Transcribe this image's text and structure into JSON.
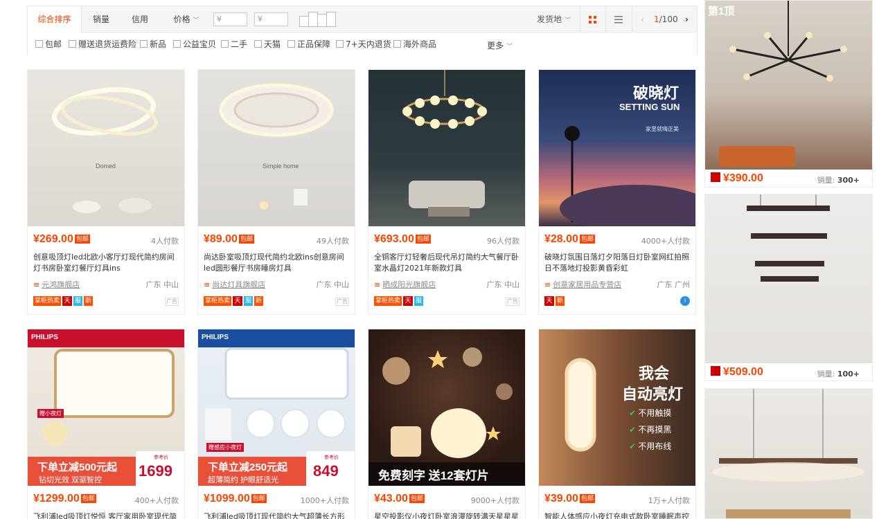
{
  "filter": {
    "sort_tabs": [
      "综合排序",
      "销量",
      "信用",
      "价格"
    ],
    "price_placeholder_min": "¥",
    "price_placeholder_max": "¥",
    "price_dash": "-",
    "ship_from": "发货地",
    "pager": {
      "current": "1",
      "total": "/100"
    },
    "checkboxes": [
      "包邮",
      "赠送退货运费险",
      "新品",
      "公益宝贝",
      "二手",
      "天猫",
      "正品保障",
      "7+天内退货",
      "海外商品"
    ],
    "more": "更多"
  },
  "products": [
    {
      "price": "¥269.00",
      "post": "包邮",
      "deals": "4人付款",
      "title": "创意吸顶灯led北欧小客厅灯现代简约房间灯书房卧室灯餐厅灯具ins",
      "shop": "元鸿旗舰店",
      "loc": "广东 中山",
      "badges": [
        "掌柜热卖",
        "天",
        "服",
        "新"
      ],
      "ad": "广告",
      "img_text": "Domed"
    },
    {
      "price": "¥89.00",
      "post": "包邮",
      "deals": "49人付款",
      "title": "尚达卧室吸顶灯现代简约北欧ins创意房间led圆形餐厅书房睡房灯具",
      "shop": "尚达灯具旗舰店",
      "loc": "广东 中山",
      "badges": [
        "掌柜热卖",
        "天",
        "服",
        "新"
      ],
      "ad": "广告",
      "img_text": "Simple home"
    },
    {
      "price": "¥693.00",
      "post": "包邮",
      "deals": "96人付款",
      "title": "全铜客厅灯轻奢后现代吊灯简约大气餐厅卧室水晶灯2021年新款灯具",
      "shop": "晒成阳光旗舰店",
      "loc": "广东 中山",
      "badges": [
        "掌柜热卖",
        "天",
        "服"
      ],
      "ad": "广告",
      "img_text": ""
    },
    {
      "price": "¥28.00",
      "post": "包邮",
      "deals": "4000+人付款",
      "title": "破晓灯氛围日落灯夕阳落日灯卧室网红拍照日不落地灯投影黄昏彩虹",
      "shop": "创意家居用品专营店",
      "loc": "广东 广州",
      "badges": [
        "天",
        "新"
      ],
      "ad": "",
      "img_text": "破晓灯",
      "img_text2": "SETTING SUN",
      "img_text3": "家里就嗨正美"
    },
    {
      "price": "¥1299.00",
      "post": "包邮",
      "deals": "400+人付款",
      "title": "飞利浦led吸顶灯悦恒 客厅家用卧室现代简",
      "img_text": "下单立减500元起",
      "img_text2": "钻切光效 双驱智控",
      "img_text3": "1699",
      "img_text4": "PHILIPS",
      "img_text5": "参考价",
      "img_text6": "赠小夜灯"
    },
    {
      "price": "¥1099.00",
      "post": "包邮",
      "deals": "1000+人付款",
      "title": "飞利浦led吸顶灯现代简约大气超薄长方形",
      "img_text": "下单立减250元起",
      "img_text2": "超薄简约 护眼舒适光",
      "img_text3": "849",
      "img_text4": "PHILIPS",
      "img_text5": "参考价",
      "img_text6": "赠感应小夜灯"
    },
    {
      "price": "¥43.00",
      "post": "包邮",
      "deals": "9000+人付款",
      "title": "星空投影仪小夜灯卧室浪漫旋转满天星星星",
      "img_text": "免费刻字 送12套灯片"
    },
    {
      "price": "¥39.00",
      "post": "包邮",
      "deals": "1万+人付款",
      "title": "智能人体感应小夜灯充电式款卧室睡眠声控",
      "img_text": "我会",
      "img_text2": "自动亮灯",
      "features": [
        "不用触摸",
        "不再摸黑",
        "不用布线"
      ]
    }
  ],
  "side": [
    {
      "price": "¥390.00",
      "sales_label": "销量:",
      "sales": "300+",
      "img_text": "第1顶"
    },
    {
      "price": "¥509.00",
      "sales_label": "销量:",
      "sales": "100+"
    },
    {}
  ],
  "colors": {
    "accent": "#ff4400",
    "tmall": "#cc0000"
  }
}
